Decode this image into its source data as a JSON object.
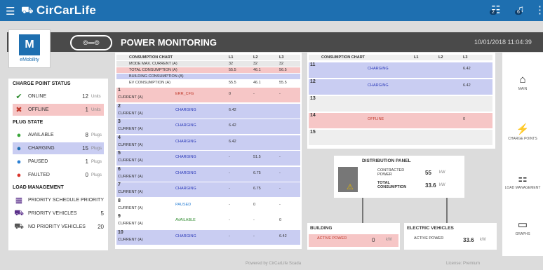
{
  "topbar": {
    "brand": "CirCarLife",
    "badge1": "2",
    "badge2": "6"
  },
  "header": {
    "title": "POWER MONITORING",
    "datetime": "10/01/2018 11:04:39"
  },
  "logo": {
    "text": "eMobility"
  },
  "status": {
    "charge_title": "CHARGE POINT STATUS",
    "online": {
      "label": "ONLINE",
      "value": "12",
      "unit": "Units"
    },
    "offline": {
      "label": "OFFLINE",
      "value": "1",
      "unit": "Units"
    },
    "plug_title": "PLUG STATE",
    "available": {
      "label": "AVAILABLE",
      "value": "8",
      "unit": "Plugs"
    },
    "charging": {
      "label": "CHARGING",
      "value": "15",
      "unit": "Plugs"
    },
    "paused": {
      "label": "PAUSED",
      "value": "1",
      "unit": "Plugs"
    },
    "faulted": {
      "label": "FAULTED",
      "value": "0",
      "unit": "Plugs"
    },
    "load_title": "LOAD MANAGEMENT",
    "priority_schedule": {
      "label": "PRIORITY SCHEDULE",
      "value": "PRIORITY"
    },
    "priority_vehicles": {
      "label": "PRIORITY VEHICLES",
      "value": "5"
    },
    "no_priority": {
      "label": "NO PRIORITY VEHICLES",
      "value": "20"
    }
  },
  "consumption": {
    "title": "CONSUMPTION CHART",
    "l1": "L1",
    "l2": "L2",
    "l3": "L3",
    "rows": [
      {
        "label": "MODE MAX. CURRENT (A)",
        "l1": "32",
        "l2": "32",
        "l3": "32"
      },
      {
        "label": "TOTAL CONSUMPTION (A)",
        "l1": "55.5",
        "l2": "46.1",
        "l3": "56.5"
      },
      {
        "label": "BUILDING CONSUMPTION (A)",
        "l1": "",
        "l2": "",
        "l3": ""
      },
      {
        "label": "EV CONSUMPTION (A)",
        "l1": "55.5",
        "l2": "46.1",
        "l3": "55.5"
      }
    ]
  },
  "points": [
    {
      "n": "1",
      "sub": "CURRENT (A)",
      "state": "ERR_CFG",
      "l1": "0",
      "l2": "-",
      "l3": "-"
    },
    {
      "n": "2",
      "sub": "CURRENT (A)",
      "state": "CHARGING",
      "l1": "6.42",
      "l2": "",
      "l3": ""
    },
    {
      "n": "3",
      "sub": "CURRENT (A)",
      "state": "CHARGING",
      "l1": "6.42",
      "l2": "",
      "l3": ""
    },
    {
      "n": "4",
      "sub": "CURRENT (A)",
      "state": "CHARGING",
      "l1": "6.42",
      "l2": "",
      "l3": ""
    },
    {
      "n": "5",
      "sub": "CURRENT (A)",
      "state": "CHARGING",
      "l1": "-",
      "l2": "51.5",
      "l3": "-"
    },
    {
      "n": "6",
      "sub": "CURRENT (A)",
      "state": "CHARGING",
      "l1": "-",
      "l2": "6.75",
      "l3": "-"
    },
    {
      "n": "7",
      "sub": "CURRENT (A)",
      "state": "CHARGING",
      "l1": "-",
      "l2": "6.75",
      "l3": "-"
    },
    {
      "n": "8",
      "sub": "CURRENT (A)",
      "state": "PAUSED",
      "l1": "-",
      "l2": "0",
      "l3": "-"
    },
    {
      "n": "9",
      "sub": "CURRENT (A)",
      "state": "AVAILABLE",
      "l1": "-",
      "l2": "-",
      "l3": "0"
    },
    {
      "n": "10",
      "sub": "CURRENT (A)",
      "state": "CHARGING",
      "l1": "-",
      "l2": "-",
      "l3": "6.42"
    }
  ],
  "right": {
    "title": "CONSUMPTION CHART",
    "l1": "L1",
    "l2": "L2",
    "l3": "L3",
    "points": [
      {
        "n": "11",
        "state": "CHARGING",
        "l3": "6.42"
      },
      {
        "n": "12",
        "state": "CHARGING",
        "l3": "6.42"
      },
      {
        "n": "13",
        "state": "",
        "l3": ""
      },
      {
        "n": "14",
        "state": "OFFLINE",
        "l3": "0"
      },
      {
        "n": "15",
        "state": "",
        "l3": ""
      }
    ]
  },
  "distribution": {
    "title": "DISTRIBUTION PANEL",
    "contracted_label": "CONTRACTED POWER",
    "contracted": "55",
    "total_label": "TOTAL CONSUMPTION",
    "total": "33.6",
    "unit": "kW"
  },
  "building": {
    "title": "BUILDING",
    "label": "ACTIVE POWER",
    "value": "0",
    "unit": "kW"
  },
  "ev": {
    "title": "ELECTRIC VEHICLES",
    "label": "ACTIVE POWER",
    "value": "33.6",
    "unit": "kW"
  },
  "side": {
    "main": "MAIN",
    "charge": "CHARGE POINTS",
    "load": "LOAD MANAGEMENT",
    "graphs": "GRAPHS"
  },
  "footer": {
    "powered": "Powered by CirCarLife Scada",
    "license": "License: Premium"
  }
}
